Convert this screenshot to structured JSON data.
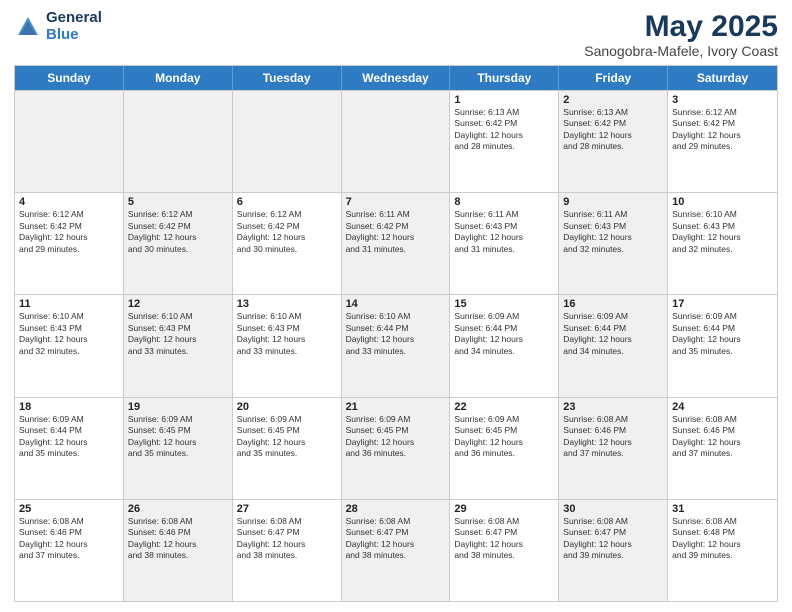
{
  "header": {
    "logo_general": "General",
    "logo_blue": "Blue",
    "title": "May 2025",
    "location": "Sanogobra-Mafele, Ivory Coast"
  },
  "weekdays": [
    "Sunday",
    "Monday",
    "Tuesday",
    "Wednesday",
    "Thursday",
    "Friday",
    "Saturday"
  ],
  "rows": [
    [
      {
        "day": "",
        "text": "",
        "shaded": true
      },
      {
        "day": "",
        "text": "",
        "shaded": true
      },
      {
        "day": "",
        "text": "",
        "shaded": true
      },
      {
        "day": "",
        "text": "",
        "shaded": true
      },
      {
        "day": "1",
        "text": "Sunrise: 6:13 AM\nSunset: 6:42 PM\nDaylight: 12 hours\nand 28 minutes."
      },
      {
        "day": "2",
        "text": "Sunrise: 6:13 AM\nSunset: 6:42 PM\nDaylight: 12 hours\nand 28 minutes.",
        "shaded": true
      },
      {
        "day": "3",
        "text": "Sunrise: 6:12 AM\nSunset: 6:42 PM\nDaylight: 12 hours\nand 29 minutes."
      }
    ],
    [
      {
        "day": "4",
        "text": "Sunrise: 6:12 AM\nSunset: 6:42 PM\nDaylight: 12 hours\nand 29 minutes."
      },
      {
        "day": "5",
        "text": "Sunrise: 6:12 AM\nSunset: 6:42 PM\nDaylight: 12 hours\nand 30 minutes.",
        "shaded": true
      },
      {
        "day": "6",
        "text": "Sunrise: 6:12 AM\nSunset: 6:42 PM\nDaylight: 12 hours\nand 30 minutes."
      },
      {
        "day": "7",
        "text": "Sunrise: 6:11 AM\nSunset: 6:42 PM\nDaylight: 12 hours\nand 31 minutes.",
        "shaded": true
      },
      {
        "day": "8",
        "text": "Sunrise: 6:11 AM\nSunset: 6:43 PM\nDaylight: 12 hours\nand 31 minutes."
      },
      {
        "day": "9",
        "text": "Sunrise: 6:11 AM\nSunset: 6:43 PM\nDaylight: 12 hours\nand 32 minutes.",
        "shaded": true
      },
      {
        "day": "10",
        "text": "Sunrise: 6:10 AM\nSunset: 6:43 PM\nDaylight: 12 hours\nand 32 minutes."
      }
    ],
    [
      {
        "day": "11",
        "text": "Sunrise: 6:10 AM\nSunset: 6:43 PM\nDaylight: 12 hours\nand 32 minutes."
      },
      {
        "day": "12",
        "text": "Sunrise: 6:10 AM\nSunset: 6:43 PM\nDaylight: 12 hours\nand 33 minutes.",
        "shaded": true
      },
      {
        "day": "13",
        "text": "Sunrise: 6:10 AM\nSunset: 6:43 PM\nDaylight: 12 hours\nand 33 minutes."
      },
      {
        "day": "14",
        "text": "Sunrise: 6:10 AM\nSunset: 6:44 PM\nDaylight: 12 hours\nand 33 minutes.",
        "shaded": true
      },
      {
        "day": "15",
        "text": "Sunrise: 6:09 AM\nSunset: 6:44 PM\nDaylight: 12 hours\nand 34 minutes."
      },
      {
        "day": "16",
        "text": "Sunrise: 6:09 AM\nSunset: 6:44 PM\nDaylight: 12 hours\nand 34 minutes.",
        "shaded": true
      },
      {
        "day": "17",
        "text": "Sunrise: 6:09 AM\nSunset: 6:44 PM\nDaylight: 12 hours\nand 35 minutes."
      }
    ],
    [
      {
        "day": "18",
        "text": "Sunrise: 6:09 AM\nSunset: 6:44 PM\nDaylight: 12 hours\nand 35 minutes."
      },
      {
        "day": "19",
        "text": "Sunrise: 6:09 AM\nSunset: 6:45 PM\nDaylight: 12 hours\nand 35 minutes.",
        "shaded": true
      },
      {
        "day": "20",
        "text": "Sunrise: 6:09 AM\nSunset: 6:45 PM\nDaylight: 12 hours\nand 35 minutes."
      },
      {
        "day": "21",
        "text": "Sunrise: 6:09 AM\nSunset: 6:45 PM\nDaylight: 12 hours\nand 36 minutes.",
        "shaded": true
      },
      {
        "day": "22",
        "text": "Sunrise: 6:09 AM\nSunset: 6:45 PM\nDaylight: 12 hours\nand 36 minutes."
      },
      {
        "day": "23",
        "text": "Sunrise: 6:08 AM\nSunset: 6:46 PM\nDaylight: 12 hours\nand 37 minutes.",
        "shaded": true
      },
      {
        "day": "24",
        "text": "Sunrise: 6:08 AM\nSunset: 6:46 PM\nDaylight: 12 hours\nand 37 minutes."
      }
    ],
    [
      {
        "day": "25",
        "text": "Sunrise: 6:08 AM\nSunset: 6:46 PM\nDaylight: 12 hours\nand 37 minutes."
      },
      {
        "day": "26",
        "text": "Sunrise: 6:08 AM\nSunset: 6:46 PM\nDaylight: 12 hours\nand 38 minutes.",
        "shaded": true
      },
      {
        "day": "27",
        "text": "Sunrise: 6:08 AM\nSunset: 6:47 PM\nDaylight: 12 hours\nand 38 minutes."
      },
      {
        "day": "28",
        "text": "Sunrise: 6:08 AM\nSunset: 6:47 PM\nDaylight: 12 hours\nand 38 minutes.",
        "shaded": true
      },
      {
        "day": "29",
        "text": "Sunrise: 6:08 AM\nSunset: 6:47 PM\nDaylight: 12 hours\nand 38 minutes."
      },
      {
        "day": "30",
        "text": "Sunrise: 6:08 AM\nSunset: 6:47 PM\nDaylight: 12 hours\nand 39 minutes.",
        "shaded": true
      },
      {
        "day": "31",
        "text": "Sunrise: 6:08 AM\nSunset: 6:48 PM\nDaylight: 12 hours\nand 39 minutes."
      }
    ]
  ]
}
